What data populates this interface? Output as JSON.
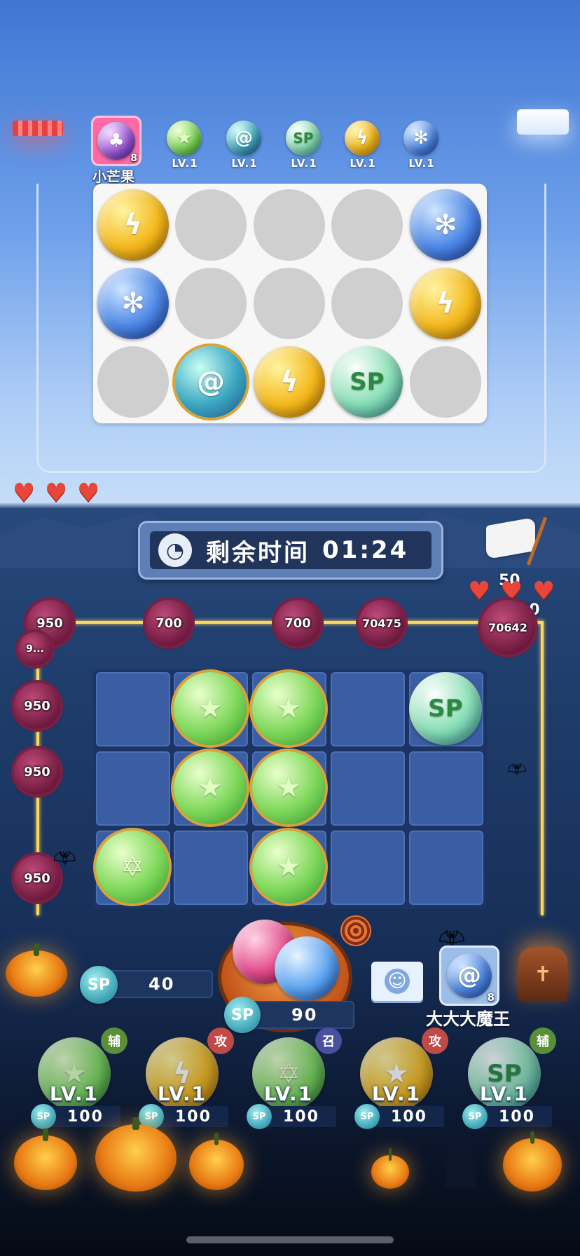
{
  "opponent": {
    "name": "小芒果",
    "avatar_level": "8",
    "hearts": 3,
    "deck": [
      {
        "icon": "leaf-star-orb-icon",
        "level": "LV.1"
      },
      {
        "icon": "tornado-orb-icon",
        "level": "LV.1"
      },
      {
        "icon": "sp-orb-icon",
        "level": "LV.1"
      },
      {
        "icon": "lightning-orb-icon",
        "level": "LV.1"
      },
      {
        "icon": "snowflake-orb-icon",
        "level": "LV.1"
      }
    ]
  },
  "timer": {
    "label": "剩余时间",
    "value": "01:24"
  },
  "flag": {
    "label": "50"
  },
  "player_hearts": 3,
  "wave": "20",
  "enemies": [
    {
      "hp": "950"
    },
    {
      "hp": "700"
    },
    {
      "hp": "700"
    },
    {
      "hp": "70475"
    },
    {
      "hp": "70642"
    },
    {
      "hp": "950"
    },
    {
      "hp": "950"
    },
    {
      "hp": "950"
    },
    {
      "hp": "9..."
    }
  ],
  "player": {
    "name": "大大大魔王",
    "avatar_level": "8",
    "sp_current": "40",
    "summon_cost": "90",
    "sp_label": "SP"
  },
  "shop": [
    {
      "level": "LV.1",
      "tag": "辅",
      "cost": "100",
      "icon": "leaf-star-orb-icon"
    },
    {
      "level": "LV.1",
      "tag": "攻",
      "cost": "100",
      "icon": "lightning-orb-icon"
    },
    {
      "level": "LV.1",
      "tag": "召",
      "cost": "100",
      "icon": "green-star-orb-icon"
    },
    {
      "level": "LV.1",
      "tag": "攻",
      "cost": "100",
      "icon": "yellow-star-orb-icon"
    },
    {
      "level": "LV.1",
      "tag": "辅",
      "cost": "100",
      "icon": "sp-orb-icon"
    }
  ],
  "colors": {
    "accent": "#ffd75a",
    "heart": "#e8463a",
    "board": "#3a5da4"
  }
}
